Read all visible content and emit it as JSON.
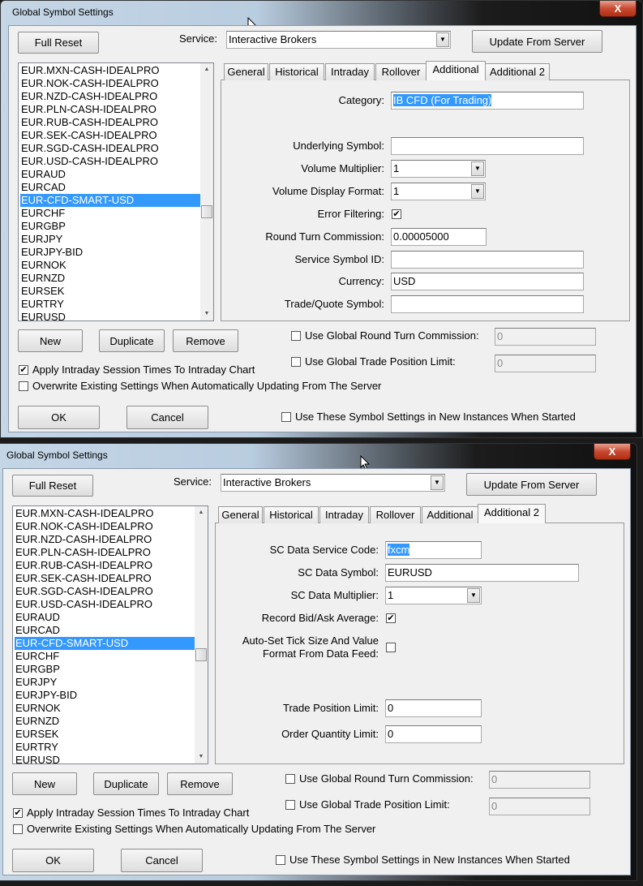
{
  "dialogs": [
    {
      "title": "Global Symbol Settings",
      "close_label": "X",
      "full_reset": "Full Reset",
      "service_label": "Service:",
      "service_value": "Interactive Brokers",
      "update_button": "Update From Server",
      "symbols": [
        "EUR.MXN-CASH-IDEALPRO",
        "EUR.NOK-CASH-IDEALPRO",
        "EUR.NZD-CASH-IDEALPRO",
        "EUR.PLN-CASH-IDEALPRO",
        "EUR.RUB-CASH-IDEALPRO",
        "EUR.SEK-CASH-IDEALPRO",
        "EUR.SGD-CASH-IDEALPRO",
        "EUR.USD-CASH-IDEALPRO",
        "EURAUD",
        "EURCAD",
        "EUR-CFD-SMART-USD",
        "EURCHF",
        "EURGBP",
        "EURJPY",
        "EURJPY-BID",
        "EURNOK",
        "EURNZD",
        "EURSEK",
        "EURTRY",
        "EURUSD"
      ],
      "selected_symbol": "EUR-CFD-SMART-USD",
      "tabs": [
        "General",
        "Historical",
        "Intraday",
        "Rollover",
        "Additional",
        "Additional 2"
      ],
      "active_tab": "Additional",
      "fields": [
        {
          "label": "Category:",
          "type": "text",
          "value": "IB CFD (For Trading)",
          "selected": true
        },
        {
          "label": "Underlying Symbol:",
          "type": "text",
          "value": ""
        },
        {
          "label": "Volume Multiplier:",
          "type": "select",
          "value": "1"
        },
        {
          "label": "Volume Display Format:",
          "type": "select",
          "value": "1"
        },
        {
          "label": "Error Filtering:",
          "type": "checkbox",
          "checked": true
        },
        {
          "label": "Round Turn Commission:",
          "type": "text",
          "value": "0.00005000"
        },
        {
          "label": "Service Symbol ID:",
          "type": "text",
          "value": ""
        },
        {
          "label": "Currency:",
          "type": "text",
          "value": "USD"
        },
        {
          "label": "Trade/Quote Symbol:",
          "type": "text",
          "value": ""
        }
      ],
      "new_button": "New",
      "duplicate_button": "Duplicate",
      "remove_button": "Remove",
      "global_rtc": {
        "label": "Use Global Round Turn Commission:",
        "checked": false,
        "value": "0"
      },
      "global_tpl": {
        "label": "Use Global Trade Position Limit:",
        "checked": false,
        "value": "0"
      },
      "apply_intraday": {
        "label": "Apply Intraday Session Times To Intraday Chart",
        "checked": true
      },
      "overwrite": {
        "label": "Overwrite Existing Settings When Automatically Updating From The Server",
        "checked": false
      },
      "ok_button": "OK",
      "cancel_button": "Cancel",
      "use_these": {
        "label": "Use These Symbol Settings in New Instances When Started",
        "checked": false
      }
    },
    {
      "title": "Global Symbol Settings",
      "close_label": "X",
      "full_reset": "Full Reset",
      "service_label": "Service:",
      "service_value": "Interactive Brokers",
      "update_button": "Update From Server",
      "symbols": [
        "EUR.MXN-CASH-IDEALPRO",
        "EUR.NOK-CASH-IDEALPRO",
        "EUR.NZD-CASH-IDEALPRO",
        "EUR.PLN-CASH-IDEALPRO",
        "EUR.RUB-CASH-IDEALPRO",
        "EUR.SEK-CASH-IDEALPRO",
        "EUR.SGD-CASH-IDEALPRO",
        "EUR.USD-CASH-IDEALPRO",
        "EURAUD",
        "EURCAD",
        "EUR-CFD-SMART-USD",
        "EURCHF",
        "EURGBP",
        "EURJPY",
        "EURJPY-BID",
        "EURNOK",
        "EURNZD",
        "EURSEK",
        "EURTRY",
        "EURUSD"
      ],
      "selected_symbol": "EUR-CFD-SMART-USD",
      "tabs": [
        "General",
        "Historical",
        "Intraday",
        "Rollover",
        "Additional",
        "Additional 2"
      ],
      "active_tab": "Additional 2",
      "fields": [
        {
          "label": "SC Data Service Code:",
          "type": "text",
          "value": "fxcm",
          "selected": true
        },
        {
          "label": "SC Data Symbol:",
          "type": "text",
          "value": "EURUSD"
        },
        {
          "label": "SC Data Multiplier:",
          "type": "select",
          "value": "1"
        },
        {
          "label": "Record Bid/Ask Average:",
          "type": "checkbox",
          "checked": true
        },
        {
          "label": "Auto-Set Tick Size And Value",
          "label2": "Format From Data Feed:",
          "type": "checkbox",
          "checked": false
        },
        {
          "label": "Trade Position Limit:",
          "type": "text",
          "value": "0"
        },
        {
          "label": "Order Quantity Limit:",
          "type": "text",
          "value": "0"
        }
      ],
      "new_button": "New",
      "duplicate_button": "Duplicate",
      "remove_button": "Remove",
      "global_rtc": {
        "label": "Use Global Round Turn Commission:",
        "checked": false,
        "value": "0"
      },
      "global_tpl": {
        "label": "Use Global Trade Position Limit:",
        "checked": false,
        "value": "0"
      },
      "apply_intraday": {
        "label": "Apply Intraday Session Times To Intraday Chart",
        "checked": true
      },
      "overwrite": {
        "label": "Overwrite Existing Settings When Automatically Updating From The Server",
        "checked": false
      },
      "ok_button": "OK",
      "cancel_button": "Cancel",
      "use_these": {
        "label": "Use These Symbol Settings in New Instances When Started",
        "checked": false
      }
    }
  ]
}
